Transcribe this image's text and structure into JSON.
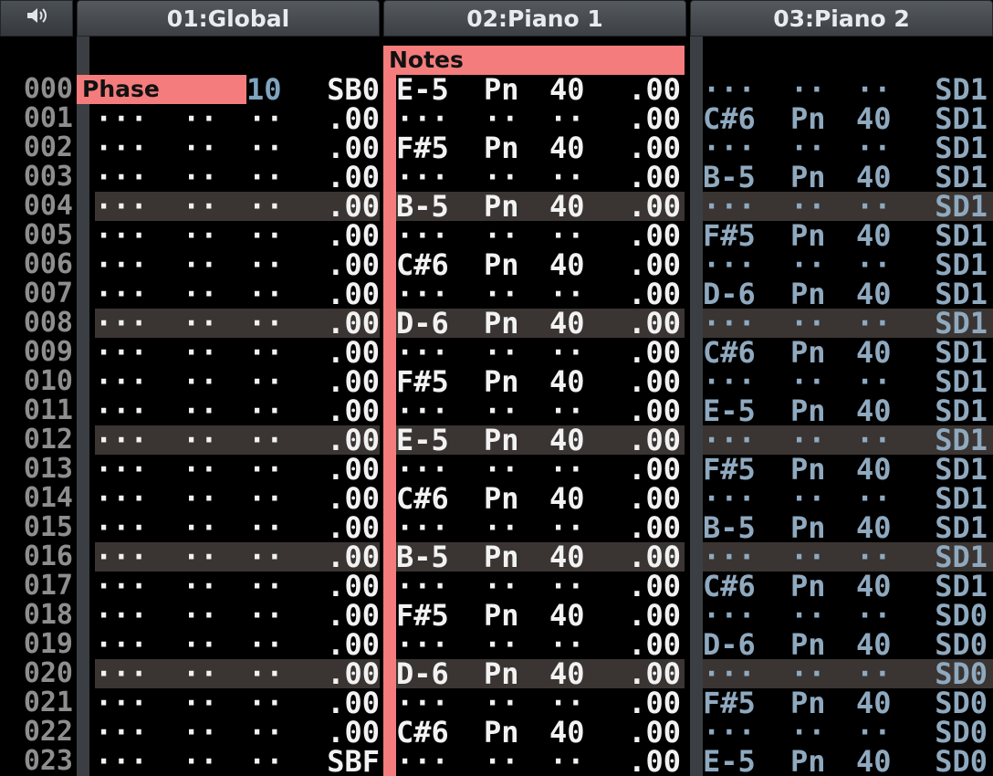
{
  "header": {
    "speaker_icon": "speaker-icon",
    "channels": [
      "01:Global",
      "02:Piano 1",
      "03:Piano 2"
    ]
  },
  "row_numbers": [
    "000",
    "001",
    "002",
    "003",
    "004",
    "005",
    "006",
    "007",
    "008",
    "009",
    "010",
    "011",
    "012",
    "013",
    "014",
    "015",
    "016",
    "017",
    "018",
    "019",
    "020",
    "021",
    "022",
    "023"
  ],
  "tags": {
    "phase": "Phase",
    "notes": "Notes"
  },
  "global_first_row": {
    "value": "10",
    "fx": "SB0"
  },
  "global_rows": [
    [
      "",
      "",
      "",
      ""
    ],
    [
      "···",
      "··",
      "··",
      ".00"
    ],
    [
      "···",
      "··",
      "··",
      ".00"
    ],
    [
      "···",
      "··",
      "··",
      ".00"
    ],
    [
      "···",
      "··",
      "··",
      ".00"
    ],
    [
      "···",
      "··",
      "··",
      ".00"
    ],
    [
      "···",
      "··",
      "··",
      ".00"
    ],
    [
      "···",
      "··",
      "··",
      ".00"
    ],
    [
      "···",
      "··",
      "··",
      ".00"
    ],
    [
      "···",
      "··",
      "··",
      ".00"
    ],
    [
      "···",
      "··",
      "··",
      ".00"
    ],
    [
      "···",
      "··",
      "··",
      ".00"
    ],
    [
      "···",
      "··",
      "··",
      ".00"
    ],
    [
      "···",
      "··",
      "··",
      ".00"
    ],
    [
      "···",
      "··",
      "··",
      ".00"
    ],
    [
      "···",
      "··",
      "··",
      ".00"
    ],
    [
      "···",
      "··",
      "··",
      ".00"
    ],
    [
      "···",
      "··",
      "··",
      ".00"
    ],
    [
      "···",
      "··",
      "··",
      ".00"
    ],
    [
      "···",
      "··",
      "··",
      ".00"
    ],
    [
      "···",
      "··",
      "··",
      ".00"
    ],
    [
      "···",
      "··",
      "··",
      ".00"
    ],
    [
      "···",
      "··",
      "··",
      ".00"
    ],
    [
      "···",
      "··",
      "··",
      "SBF"
    ]
  ],
  "piano1_rows": [
    [
      "E-5",
      "Pn",
      "40",
      ".00"
    ],
    [
      "···",
      "··",
      "··",
      ".00"
    ],
    [
      "F#5",
      "Pn",
      "40",
      ".00"
    ],
    [
      "···",
      "··",
      "··",
      ".00"
    ],
    [
      "B-5",
      "Pn",
      "40",
      ".00"
    ],
    [
      "···",
      "··",
      "··",
      ".00"
    ],
    [
      "C#6",
      "Pn",
      "40",
      ".00"
    ],
    [
      "···",
      "··",
      "··",
      ".00"
    ],
    [
      "D-6",
      "Pn",
      "40",
      ".00"
    ],
    [
      "···",
      "··",
      "··",
      ".00"
    ],
    [
      "F#5",
      "Pn",
      "40",
      ".00"
    ],
    [
      "···",
      "··",
      "··",
      ".00"
    ],
    [
      "E-5",
      "Pn",
      "40",
      ".00"
    ],
    [
      "···",
      "··",
      "··",
      ".00"
    ],
    [
      "C#6",
      "Pn",
      "40",
      ".00"
    ],
    [
      "···",
      "··",
      "··",
      ".00"
    ],
    [
      "B-5",
      "Pn",
      "40",
      ".00"
    ],
    [
      "···",
      "··",
      "··",
      ".00"
    ],
    [
      "F#5",
      "Pn",
      "40",
      ".00"
    ],
    [
      "···",
      "··",
      "··",
      ".00"
    ],
    [
      "D-6",
      "Pn",
      "40",
      ".00"
    ],
    [
      "···",
      "··",
      "··",
      ".00"
    ],
    [
      "C#6",
      "Pn",
      "40",
      ".00"
    ],
    [
      "···",
      "··",
      "··",
      ".00"
    ]
  ],
  "piano2_rows": [
    [
      "···",
      "··",
      "··",
      "SD1"
    ],
    [
      "C#6",
      "Pn",
      "40",
      "SD1"
    ],
    [
      "···",
      "··",
      "··",
      "SD1"
    ],
    [
      "B-5",
      "Pn",
      "40",
      "SD1"
    ],
    [
      "···",
      "··",
      "··",
      "SD1"
    ],
    [
      "F#5",
      "Pn",
      "40",
      "SD1"
    ],
    [
      "···",
      "··",
      "··",
      "SD1"
    ],
    [
      "D-6",
      "Pn",
      "40",
      "SD1"
    ],
    [
      "···",
      "··",
      "··",
      "SD1"
    ],
    [
      "C#6",
      "Pn",
      "40",
      "SD1"
    ],
    [
      "···",
      "··",
      "··",
      "SD1"
    ],
    [
      "E-5",
      "Pn",
      "40",
      "SD1"
    ],
    [
      "···",
      "··",
      "··",
      "SD1"
    ],
    [
      "F#5",
      "Pn",
      "40",
      "SD1"
    ],
    [
      "···",
      "··",
      "··",
      "SD1"
    ],
    [
      "B-5",
      "Pn",
      "40",
      "SD1"
    ],
    [
      "···",
      "··",
      "··",
      "SD1"
    ],
    [
      "C#6",
      "Pn",
      "40",
      "SD1"
    ],
    [
      "···",
      "··",
      "··",
      "SD0"
    ],
    [
      "D-6",
      "Pn",
      "40",
      "SD0"
    ],
    [
      "···",
      "··",
      "··",
      "SD0"
    ],
    [
      "F#5",
      "Pn",
      "40",
      "SD0"
    ],
    [
      "···",
      "··",
      "··",
      "SD0"
    ],
    [
      "E-5",
      "Pn",
      "40",
      "SD0"
    ]
  ],
  "highlight_rows": [
    4,
    8,
    12,
    16,
    20
  ],
  "colors": {
    "tag_red": "#f47c7c",
    "highlight_bg": "#3a3532",
    "piano2_text": "#8fa9bf",
    "row_number": "#8e8e8e"
  }
}
